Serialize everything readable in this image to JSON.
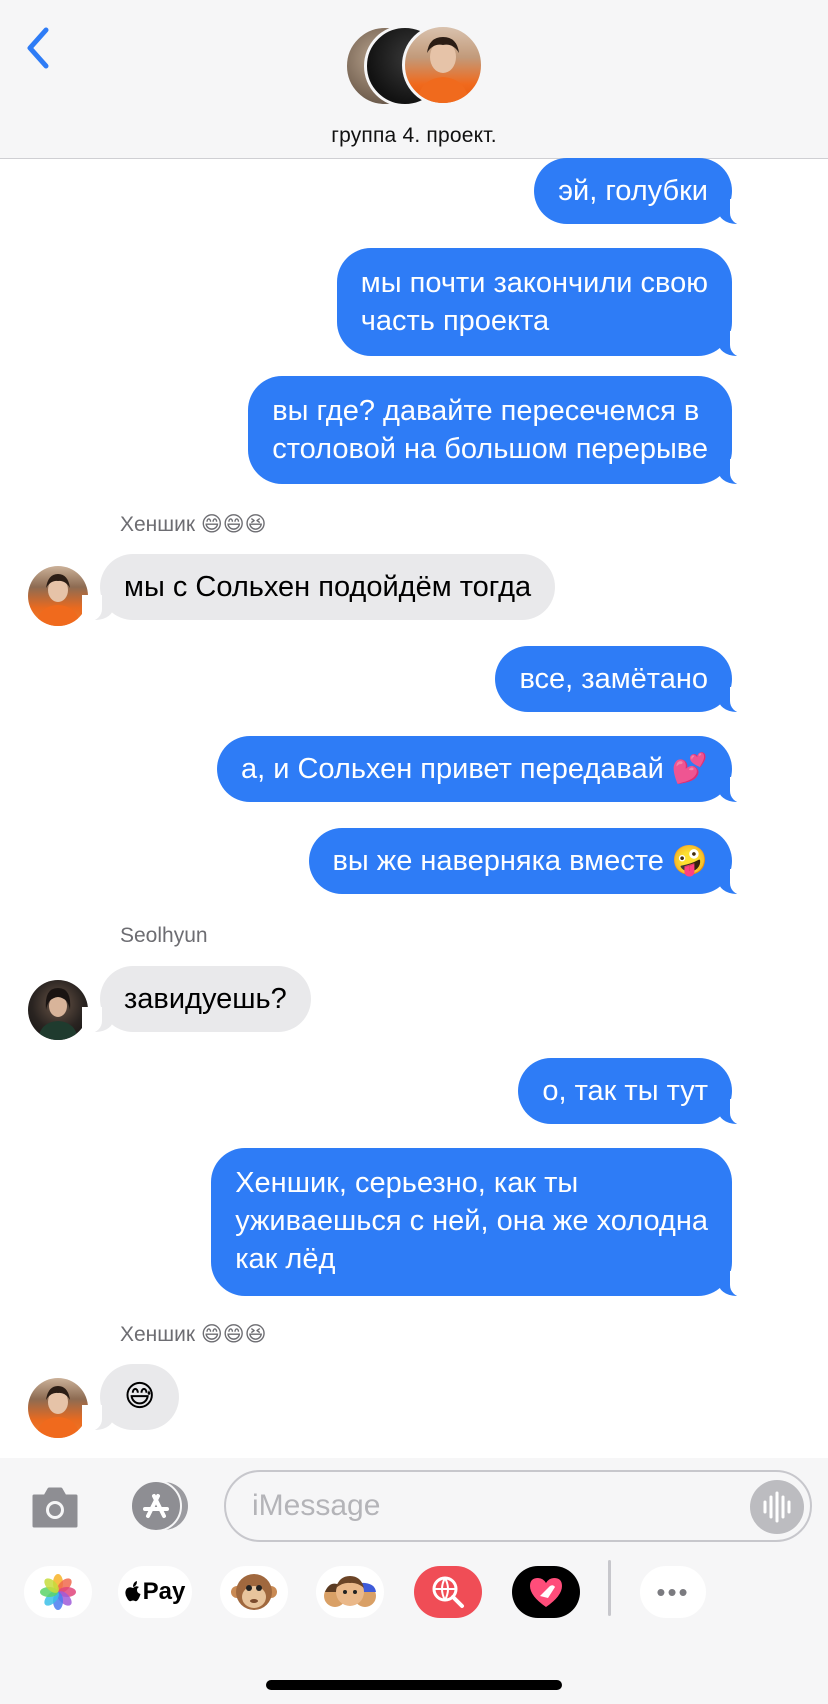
{
  "header": {
    "group_name": "группа 4. проект."
  },
  "messages": [
    {
      "side": "out",
      "text": "эй, голубки"
    },
    {
      "side": "out",
      "lines": [
        "мы почти закончили свою",
        "часть проекта"
      ]
    },
    {
      "side": "out",
      "lines": [
        "вы где? давайте пересечемся в",
        "столовой на большом перерыве"
      ]
    },
    {
      "sender": "Хеншик 😄😄😆"
    },
    {
      "side": "in",
      "text": "мы с Сольхен подойдём тогда"
    },
    {
      "side": "out",
      "text": "все, замётано"
    },
    {
      "side": "out",
      "text": "а, и Сольхен привет передавай 💕"
    },
    {
      "side": "out",
      "text": "вы же наверняка вместе 🤪"
    },
    {
      "sender": "Seolhyun"
    },
    {
      "side": "in",
      "text": "завидуешь?"
    },
    {
      "side": "out",
      "text": "о, так ты тут"
    },
    {
      "side": "out",
      "lines": [
        "Хеншик, серьезно, как ты",
        "уживаешься с ней, она же холодна",
        "как лёд"
      ]
    },
    {
      "sender": "Хеншик 😄😄😆"
    },
    {
      "side": "in",
      "text": "😅"
    }
  ],
  "compose": {
    "placeholder": "iMessage",
    "apps": [
      "photos-icon",
      "apple-pay-icon",
      "animoji-icon",
      "memoji-icon",
      "search-images-icon",
      "digital-touch-icon",
      "more-icon"
    ],
    "apple_pay_label": "Pay",
    "more_label": "•••"
  },
  "colors": {
    "accent": "#2e7cf6",
    "incoming_bubble": "#e9e9eb",
    "header_bg": "#f6f6f7"
  }
}
